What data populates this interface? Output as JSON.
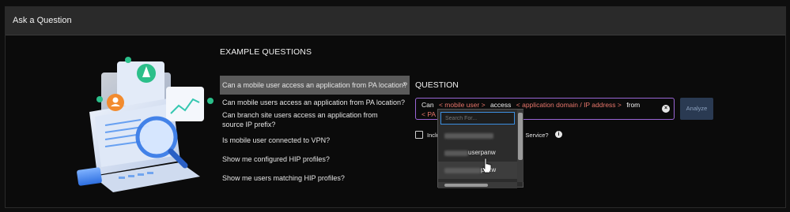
{
  "header": {
    "title": "Ask a Question"
  },
  "examples": {
    "heading": "EXAMPLE QUESTIONS",
    "items": [
      {
        "label": "Can a mobile user access an application from PA location?"
      },
      {
        "label": "Can mobile users access an application from PA location?"
      },
      {
        "label": "Can branch site users access an application from source IP prefix?"
      },
      {
        "label": "Is mobile user connected to VPN?"
      },
      {
        "label": "Show me configured HIP profiles?"
      },
      {
        "label": "Show me users matching HIP profiles?"
      }
    ],
    "chevron": "›"
  },
  "question": {
    "heading": "QUESTION",
    "tokens": {
      "can": "Can",
      "mobile_user": "< mobile user >",
      "access": "access",
      "app": "< application domain / IP address >",
      "from": "from",
      "pa": "< PA"
    },
    "clear_glyph": "×"
  },
  "analyze_label": "Analyze",
  "include": {
    "label_start": "Inclu",
    "label_end": "de Service?",
    "info_glyph": "i"
  },
  "dropdown": {
    "search_placeholder": "Search For...",
    "items": [
      {
        "suffix": ""
      },
      {
        "suffix": ""
      },
      {
        "suffix": "userpanw"
      },
      {
        "suffix": "panw"
      },
      {
        "suffix": ""
      }
    ]
  },
  "colors": {
    "accent": "#9a66d6",
    "variable": "#e8766b",
    "search_border": "#3b8ee0",
    "analyze_bg": "#2a3a52"
  }
}
